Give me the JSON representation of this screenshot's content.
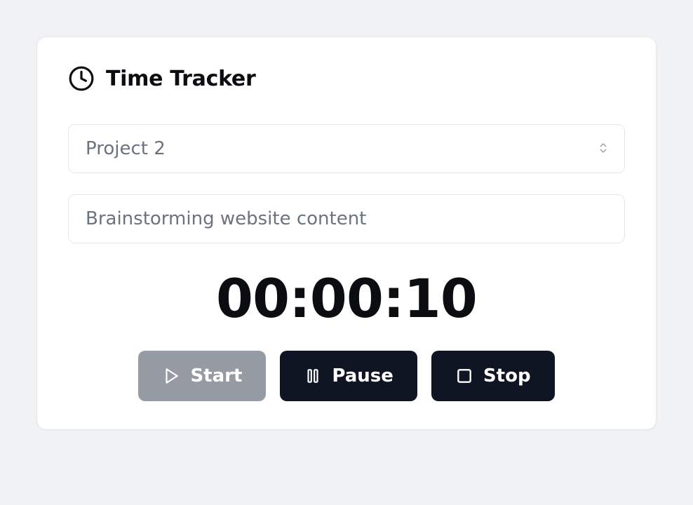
{
  "header": {
    "title": "Time Tracker"
  },
  "project_select": {
    "selected": "Project 2"
  },
  "task_input": {
    "placeholder": "Brainstorming website content",
    "value": ""
  },
  "timer": "00:00:10",
  "buttons": {
    "start": "Start",
    "pause": "Pause",
    "stop": "Stop"
  }
}
